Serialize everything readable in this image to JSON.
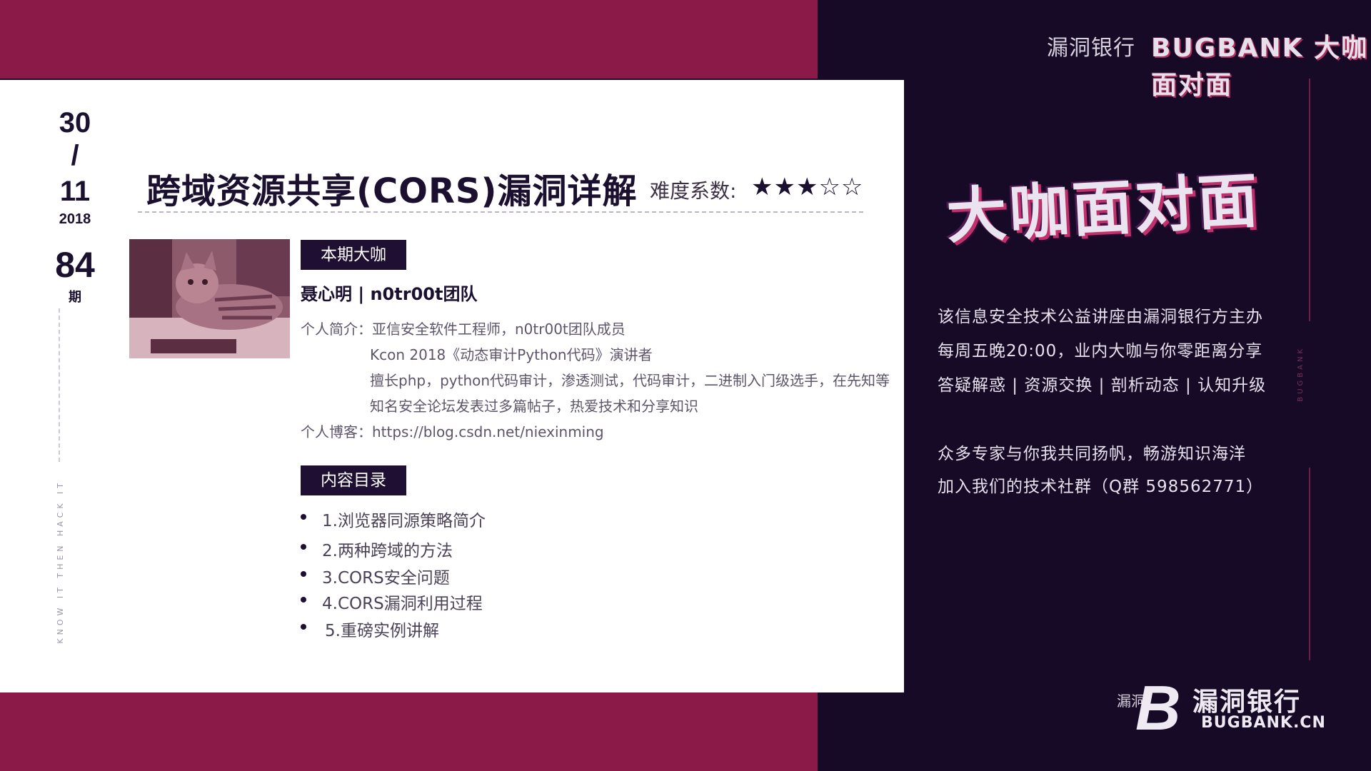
{
  "header": {
    "brand_cn": "漏洞银行",
    "brand_en": "BUGBANK",
    "program_name": "大咖面对面"
  },
  "logo": {
    "text": "大咖面对面"
  },
  "side_vertical_text": "BUGBANK",
  "intro": {
    "lines": [
      "该信息安全技术公益讲座由漏洞银行方主办",
      "每周五晚20:00，业内大咖与你零距离分享",
      "答疑解惑 | 资源交换 | 剖析动态 | 认知升级",
      "众多专家与你我共同扬帆，畅游知识海洋",
      "加入我们的技术社群（Q群 598562771）"
    ]
  },
  "bottom_brand": {
    "small": "漏洞",
    "cn": "漏洞银行",
    "en": "BUGBANK.CN",
    "mark": "B"
  },
  "date": {
    "day": "30",
    "slash": "/",
    "month": "11",
    "year": "2018"
  },
  "issue": {
    "number": "84",
    "unit": "期"
  },
  "slogan_vertical": "KNOW IT THEN HACK IT",
  "title": "跨域资源共享(CORS)漏洞详解",
  "difficulty": {
    "label": "难度系数:",
    "stars": "★★★☆☆",
    "rating": 3,
    "max": 5
  },
  "speaker_section": {
    "tag": "本期大咖",
    "name": "聂心明 | n0tr00t团队",
    "bio": [
      "个人简介：亚信安全软件工程师，n0tr00t团队成员",
      "Kcon 2018《动态审计Python代码》演讲者",
      "擅长php，python代码审计，渗透测试，代码审计，二进制入门级选手，在先知等",
      "知名安全论坛发表过多篇帖子，热爱技术和分享知识",
      "个人博客：https://blog.csdn.net/niexinming"
    ]
  },
  "toc": {
    "tag": "内容目录",
    "items": [
      "1.浏览器同源策略简介",
      "2.两种跨域的方法",
      "3.CORS安全问题",
      "4.CORS漏洞利用过程",
      "5.重磅实例讲解"
    ]
  },
  "colors": {
    "maroon": "#8b1a48",
    "dark": "#170a27",
    "ink": "#1c1030"
  }
}
